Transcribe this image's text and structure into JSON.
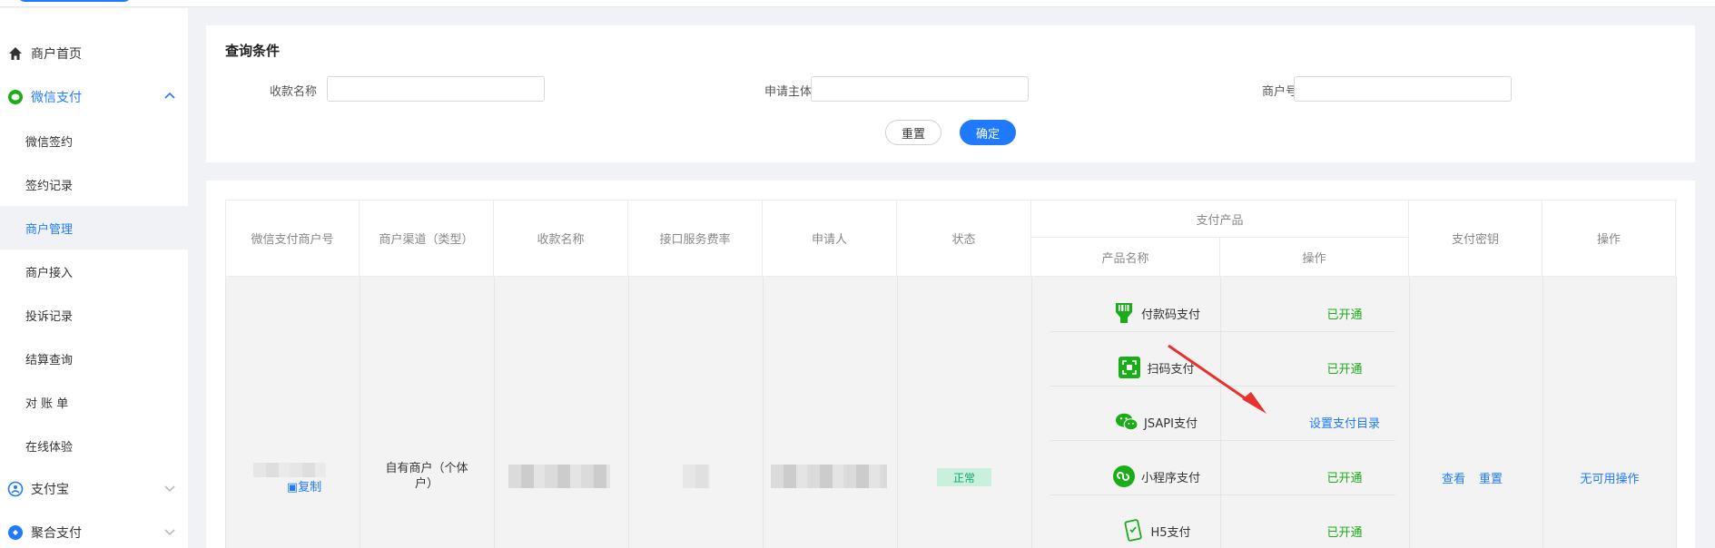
{
  "sidebar": {
    "home": "商户首页",
    "wechat_pay": "微信支付",
    "items": [
      "微信签约",
      "签约记录",
      "商户管理",
      "商户接入",
      "投诉记录",
      "结算查询",
      "对 账 单",
      "在线体验"
    ],
    "alipay": "支付宝",
    "aggregate": "聚合支付"
  },
  "query": {
    "title": "查询条件",
    "fields": [
      {
        "label": "收款名称",
        "value": ""
      },
      {
        "label": "申请主体",
        "value": ""
      },
      {
        "label": "商户号",
        "value": ""
      }
    ],
    "reset": "重置",
    "confirm": "确定"
  },
  "table": {
    "headers": [
      "微信支付商户号",
      "商户渠道（类型）",
      "收款名称",
      "接口服务费率",
      "申请人",
      "状态",
      "支付产品",
      "支付密钥",
      "操作"
    ],
    "subheaders": [
      "产品名称",
      "操作"
    ],
    "row": {
      "copy": "复制",
      "channel": "自有商户（个体户）",
      "status": "正常",
      "key_view": "查看",
      "key_reset": "重置",
      "action": "无可用操作"
    },
    "products": [
      {
        "name": "付款码支付",
        "op": "已开通",
        "icon": "barcode-pay-icon"
      },
      {
        "name": "扫码支付",
        "op": "已开通",
        "icon": "scan-pay-icon"
      },
      {
        "name": "JSAPI支付",
        "op": "设置支付目录",
        "icon": "wechat-icon"
      },
      {
        "name": "小程序支付",
        "op": "已开通",
        "icon": "mini-program-icon"
      },
      {
        "name": "H5支付",
        "op": "已开通",
        "icon": "h5-pay-icon"
      }
    ]
  },
  "colors": {
    "primary": "#1f7aff",
    "green": "#1aad19",
    "arrow": "#e8312f"
  }
}
